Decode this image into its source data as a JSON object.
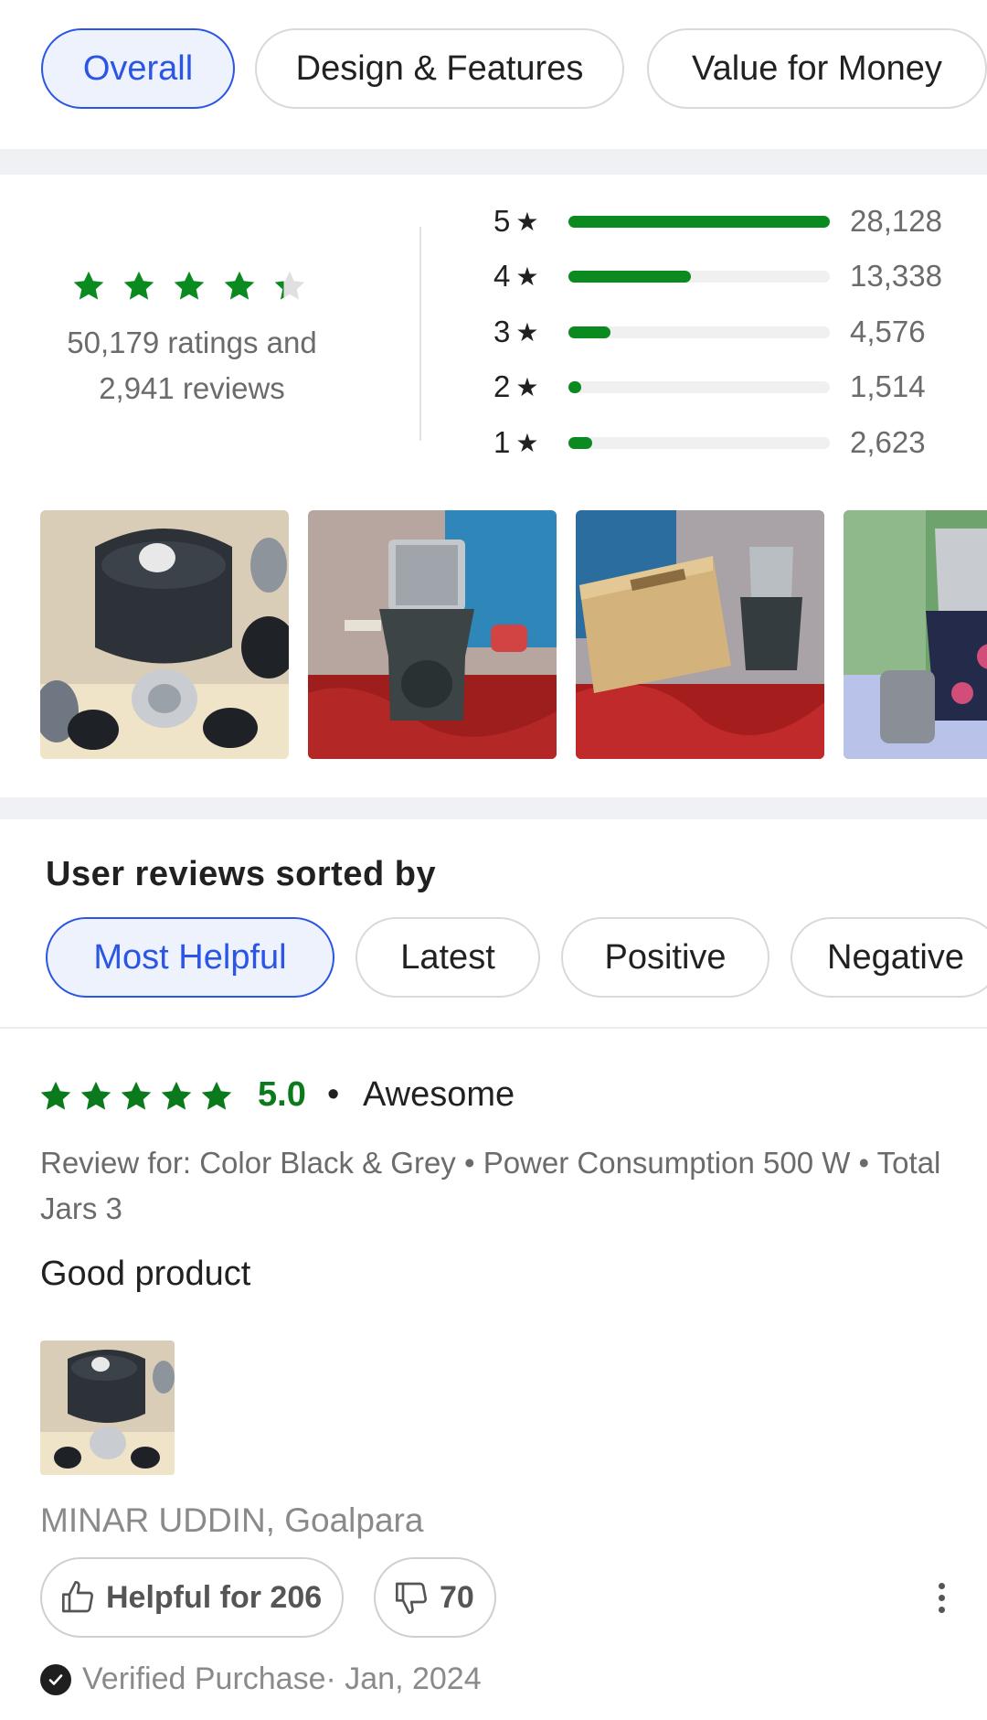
{
  "aspects": {
    "chips": [
      {
        "label": "Overall",
        "active": true
      },
      {
        "label": "Design & Features",
        "active": false
      },
      {
        "label": "Value for Money",
        "active": false
      }
    ]
  },
  "summary": {
    "rating_value": 4.3,
    "ratings_text": "50,179 ratings and",
    "reviews_text": "2,941 reviews",
    "star_color": "#0a8a1f",
    "distribution": [
      {
        "star": "5",
        "count": "28,128",
        "fraction": 1.0
      },
      {
        "star": "4",
        "count": "13,338",
        "fraction": 0.47
      },
      {
        "star": "3",
        "count": "4,576",
        "fraction": 0.16
      },
      {
        "star": "2",
        "count": "1,514",
        "fraction": 0.05
      },
      {
        "star": "1",
        "count": "2,623",
        "fraction": 0.09
      }
    ],
    "star_glyph": "★"
  },
  "photos": [
    {
      "icon": "product-photo-parts"
    },
    {
      "icon": "product-photo-mixer"
    },
    {
      "icon": "product-photo-box"
    },
    {
      "icon": "product-photo-jars"
    }
  ],
  "sort": {
    "title": "User reviews sorted by",
    "options": [
      {
        "label": "Most Helpful",
        "active": true
      },
      {
        "label": "Latest",
        "active": false
      },
      {
        "label": "Positive",
        "active": false
      },
      {
        "label": "Negative",
        "active": false
      }
    ]
  },
  "review": {
    "rating": 5,
    "score": "5.0",
    "separator": "•",
    "title": "Awesome",
    "variant": "Review for: Color Black & Grey • Power Consumption 500 W • Total Jars 3",
    "body": "Good product",
    "author": "MINAR UDDIN, Goalpara",
    "helpful_label": "Helpful for 206",
    "unhelpful_count": "70",
    "verified": "Verified Purchase· Jan, 2024",
    "accent": "#0a7a1c"
  }
}
